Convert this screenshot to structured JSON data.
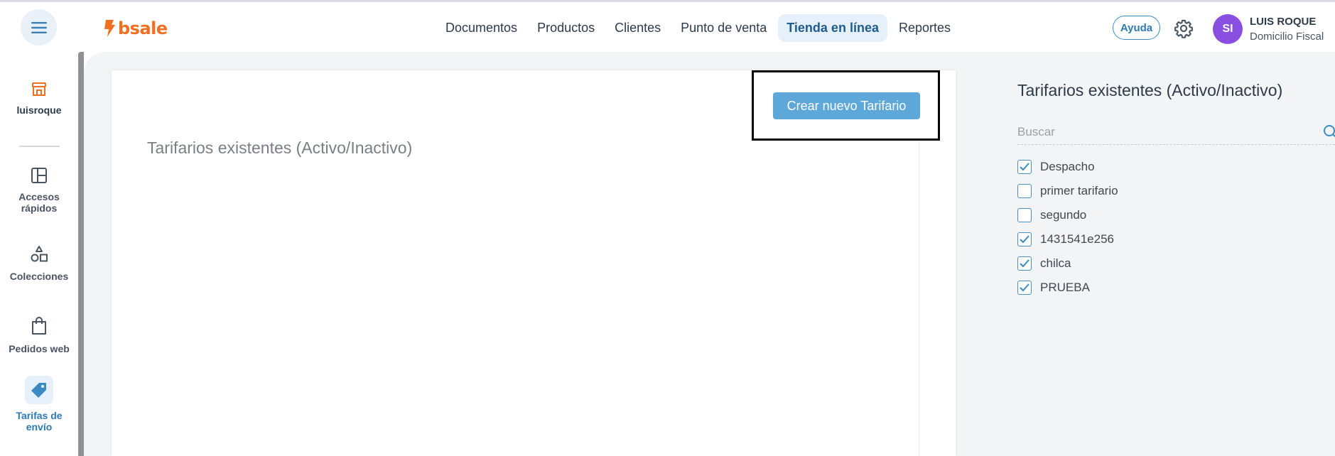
{
  "header": {
    "logo_text": "bsale",
    "nav": [
      {
        "label": "Documentos",
        "active": false
      },
      {
        "label": "Productos",
        "active": false
      },
      {
        "label": "Clientes",
        "active": false
      },
      {
        "label": "Punto de venta",
        "active": false
      },
      {
        "label": "Tienda en línea",
        "active": true
      },
      {
        "label": "Reportes",
        "active": false
      }
    ],
    "help_label": "Ayuda",
    "avatar_initials": "SI",
    "user_name": "LUIS ROQUE",
    "user_subtitle": "Domicilio Fiscal",
    "brand_color": "#f07021",
    "avatar_color": "#8a4fe0"
  },
  "sidebar": {
    "store_name": "luisroque",
    "items": [
      {
        "label": "Accesos rápidos",
        "icon": "layout-icon",
        "active": false
      },
      {
        "label": "Colecciones",
        "icon": "shapes-icon",
        "active": false
      },
      {
        "label": "Pedidos web",
        "icon": "shopping-bag-icon",
        "active": false
      },
      {
        "label": "Tarifas de envío",
        "icon": "tag-icon",
        "active": true
      }
    ]
  },
  "main": {
    "create_button_label": "Crear nuevo Tarifario",
    "card_title": "Tarifarios existentes (Activo/Inactivo)"
  },
  "right_panel": {
    "title": "Tarifarios existentes (Activo/Inactivo)",
    "search_placeholder": "Buscar",
    "tarifarios": [
      {
        "label": "Despacho",
        "checked": true
      },
      {
        "label": "primer tarifario",
        "checked": false
      },
      {
        "label": "segundo",
        "checked": false
      },
      {
        "label": "1431541e256",
        "checked": true
      },
      {
        "label": "chilca",
        "checked": true
      },
      {
        "label": "PRUEBA",
        "checked": true
      }
    ]
  }
}
